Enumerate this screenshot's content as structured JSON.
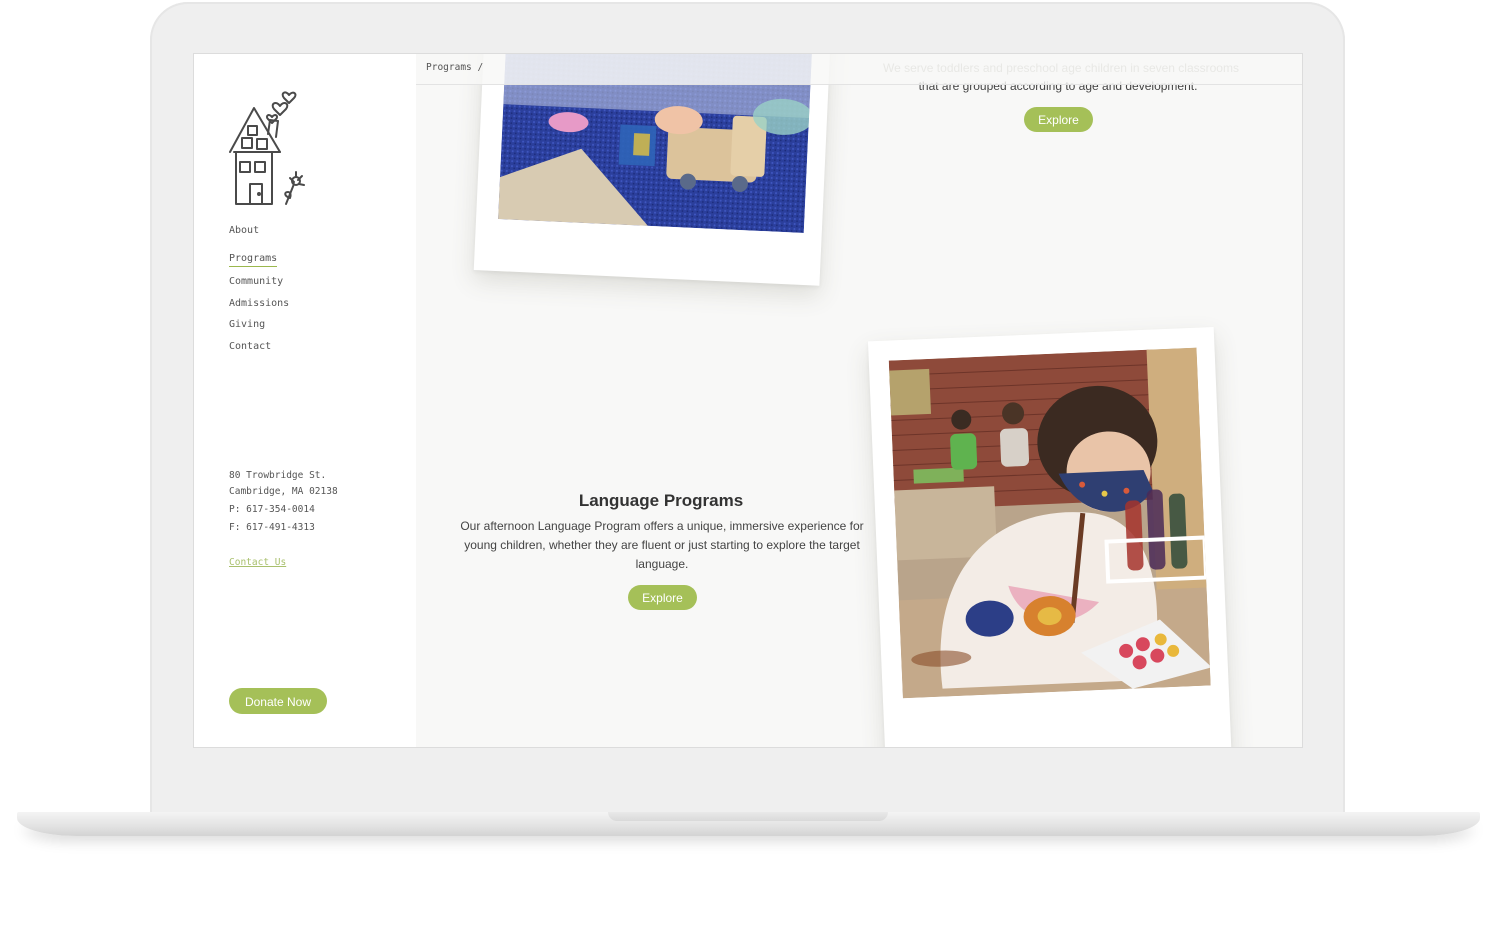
{
  "sidebar": {
    "nav": [
      {
        "label": "About"
      },
      {
        "label": "Programs"
      },
      {
        "label": "Community"
      },
      {
        "label": "Admissions"
      },
      {
        "label": "Giving"
      },
      {
        "label": "Contact"
      }
    ],
    "active_nav": "Programs",
    "address": {
      "street": "80 Trowbridge St.",
      "city": "Cambridge, MA 02138",
      "phone": "P: 617-354-0014",
      "fax": "F: 617-491-4313"
    },
    "contact_link": "Contact Us",
    "donate_label": "Donate Now"
  },
  "breadcrumb": "Programs  /",
  "top_section": {
    "faded_line": "We serve toddlers and preschool age children in seven classrooms",
    "text": "that are grouped according to age and development.",
    "explore_label": "Explore"
  },
  "language_section": {
    "title": "Language Programs",
    "text": "Our afternoon Language Program offers a unique, immersive experience for young children, whether they are fluent or just starting to explore the target language.",
    "explore_label": "Explore"
  },
  "colors": {
    "accent": "#a5c058",
    "link": "#a9c06d",
    "background": "#f8f8f7"
  }
}
